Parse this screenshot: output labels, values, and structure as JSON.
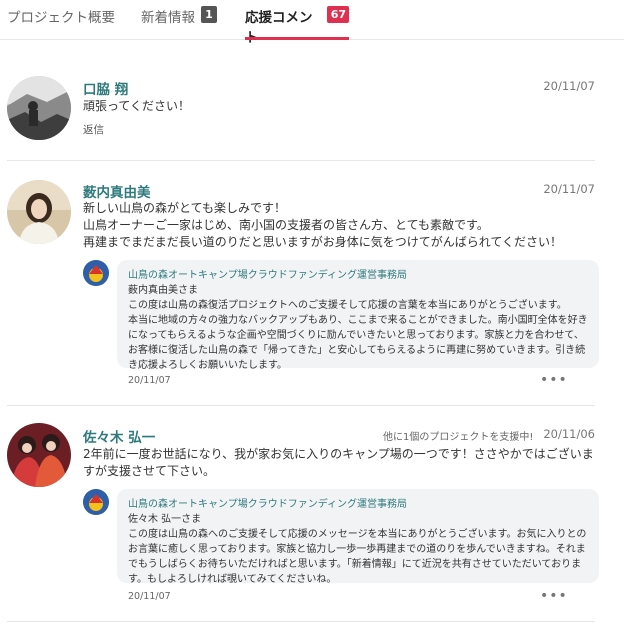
{
  "tabs": [
    {
      "label": "プロジェクト概要"
    },
    {
      "label": "新着情報",
      "badge": "1"
    },
    {
      "label": "応援コメント",
      "badge": "67"
    }
  ],
  "comments": [
    {
      "name": "口脇 翔",
      "date": "20/11/07",
      "body": "頑張ってください！",
      "reply_link": "返信"
    },
    {
      "name": "薮内真由美",
      "date": "20/11/07",
      "body": "新しい山鳥の森がとても楽しみです！\n山鳥オーナーご一家はじめ、南小国の支援者の皆さん方、とても素敵です。\n再建までまだまだ長い道のりだと思いますがお身体に気をつけてがんばられてください！",
      "reply": {
        "org": "山鳥の森オートキャンプ場クラウドファンディング運営事務局",
        "to": "薮内真由美さま",
        "text": "この度は山鳥の森復活プロジェクトへのご支援そして応援の言葉を本当にありがとうございます。\n本当に地域の方々の強力なバックアップもあり、ここまで来ることができました。南小国町全体を好きになってもらえるような企画や空間づくりに励んでいきたいと思っております。家族と力を合わせて、お客様に復活した山鳥の森で「帰ってきた」と安心してもらえるように再建に努めていきます。引き続き応援よろしくお願いいたします。",
        "date": "20/11/07",
        "more": "•••"
      }
    },
    {
      "name": "佐々木 弘一",
      "date": "20/11/06",
      "supporter": "他に1個のプロジェクトを支援中!",
      "body": "2年前に一度お世話になり、我が家お気に入りのキャンプ場の一つです！ささやかではございますが支援させて下さい。",
      "reply": {
        "org": "山鳥の森オートキャンプ場クラウドファンディング運営事務局",
        "to": "佐々木 弘一さま",
        "text": "この度は山鳥の森へのご支援そして応援のメッセージを本当にありがとうございます。お気に入りとのお言葉に癒しく思っております。家族と協力し一歩一歩再建までの道のりを歩んでいきますね。それまでもうしばらくお待ちいただければと思います。「新着情報」にて近況を共有させていただいております。もしよろしければ覗いてみてくださいね。",
        "date": "20/11/07",
        "more": "•••"
      }
    }
  ]
}
